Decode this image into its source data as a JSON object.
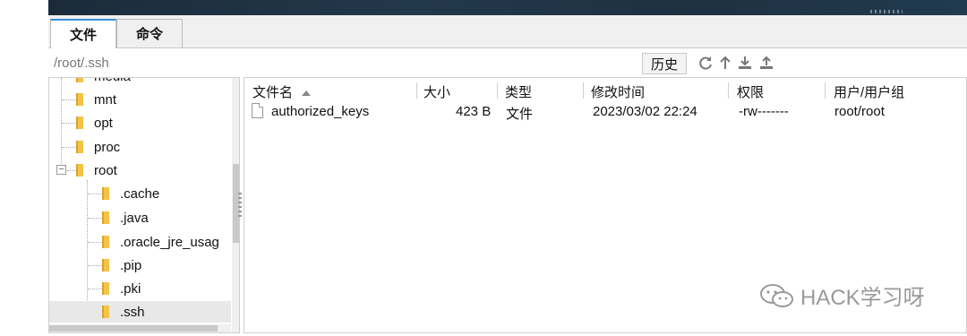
{
  "tabs": [
    {
      "label": "文件",
      "active": true
    },
    {
      "label": "命令",
      "active": false
    }
  ],
  "path_bar": {
    "path": "/root/.ssh",
    "history_label": "历史",
    "tools": [
      "refresh-icon",
      "up-icon",
      "download-icon",
      "upload-icon"
    ]
  },
  "tree": {
    "items": [
      {
        "label": "media",
        "depth": 1
      },
      {
        "label": "mnt",
        "depth": 1
      },
      {
        "label": "opt",
        "depth": 1
      },
      {
        "label": "proc",
        "depth": 1
      },
      {
        "label": "root",
        "depth": 1,
        "expanded": true
      },
      {
        "label": ".cache",
        "depth": 2
      },
      {
        "label": ".java",
        "depth": 2
      },
      {
        "label": ".oracle_jre_usag",
        "depth": 2
      },
      {
        "label": ".pip",
        "depth": 2
      },
      {
        "label": ".pki",
        "depth": 2
      },
      {
        "label": ".ssh",
        "depth": 2,
        "selected": true
      }
    ],
    "expander_symbol": "−"
  },
  "file_list": {
    "columns": [
      "文件名",
      "大小",
      "类型",
      "修改时间",
      "权限",
      "用户/用户组"
    ],
    "sorted_by": "文件名",
    "rows": [
      {
        "name": "authorized_keys",
        "size": "423 B",
        "type": "文件",
        "modified": "2023/03/02 22:24",
        "permissions": "-rw-------",
        "owner": "root/root"
      }
    ]
  },
  "watermark": {
    "text": "HACK学习呀"
  },
  "colors": {
    "tab_accent": "#3b8fd6",
    "folder": "#f3c34a",
    "selection": "#e8e8e8"
  }
}
